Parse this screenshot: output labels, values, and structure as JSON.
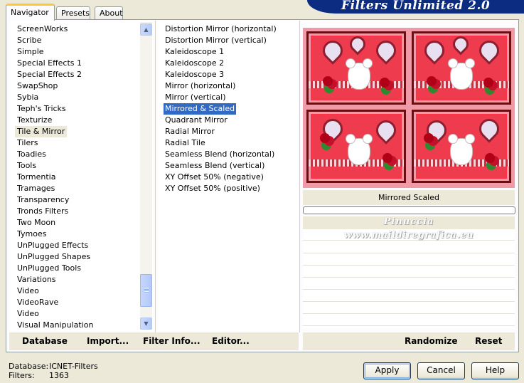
{
  "tabs": [
    {
      "label": "Navigator",
      "active": true
    },
    {
      "label": "Presets",
      "active": false
    },
    {
      "label": "About",
      "active": false
    }
  ],
  "banner": {
    "title": "Filters Unlimited 2.0"
  },
  "categories": [
    "ScreenWorks",
    "Scribe",
    "Simple",
    "Special Effects 1",
    "Special Effects 2",
    "SwapShop",
    "Sybia",
    "Teph's Tricks",
    "Texturize",
    "Tile & Mirror",
    "Tilers",
    "Toadies",
    "Tools",
    "Tormentia",
    "Tramages",
    "Transparency",
    "Tronds Filters",
    "Two Moon",
    "Tymoes",
    "UnPlugged Effects",
    "UnPlugged Shapes",
    "UnPlugged Tools",
    "Variations",
    "Video",
    "VideoRave",
    "Video",
    "Visual Manipulation"
  ],
  "selected_category": "Tile & Mirror",
  "filters": [
    "Distortion Mirror (horizontal)",
    "Distortion Mirror (vertical)",
    "Kaleidoscope 1",
    "Kaleidoscope 2",
    "Kaleidoscope 3",
    "Mirror (horizontal)",
    "Mirror (vertical)",
    "Mirrored & Scaled",
    "Quadrant Mirror",
    "Radial Mirror",
    "Radial Tile",
    "Seamless Blend (horizontal)",
    "Seamless Blend (vertical)",
    "XY Offset 50% (negative)",
    "XY Offset 50% (positive)"
  ],
  "selected_filter": "Mirrored & Scaled",
  "preview": {
    "caption": "Mirrored  Scaled",
    "progress": 0
  },
  "watermark": {
    "line1": "Pinuccia",
    "line2": "www.maildiregrafica.eu"
  },
  "toolbar": {
    "database": "Database",
    "import": "Import...",
    "filter_info": "Filter Info...",
    "editor": "Editor...",
    "randomize": "Randomize",
    "reset": "Reset"
  },
  "status": {
    "database_label": "Database:",
    "database_value": "ICNET-Filters",
    "filters_label": "Filters:",
    "filters_value": "1363"
  },
  "buttons": {
    "apply": "Apply",
    "cancel": "Cancel",
    "help": "Help"
  },
  "scrollbar": {
    "up_icon": "▲",
    "down_icon": "▼"
  },
  "colors": {
    "selection": "#316ac5",
    "banner": "#0b2c80",
    "tab_accent": "#ffc83c"
  }
}
